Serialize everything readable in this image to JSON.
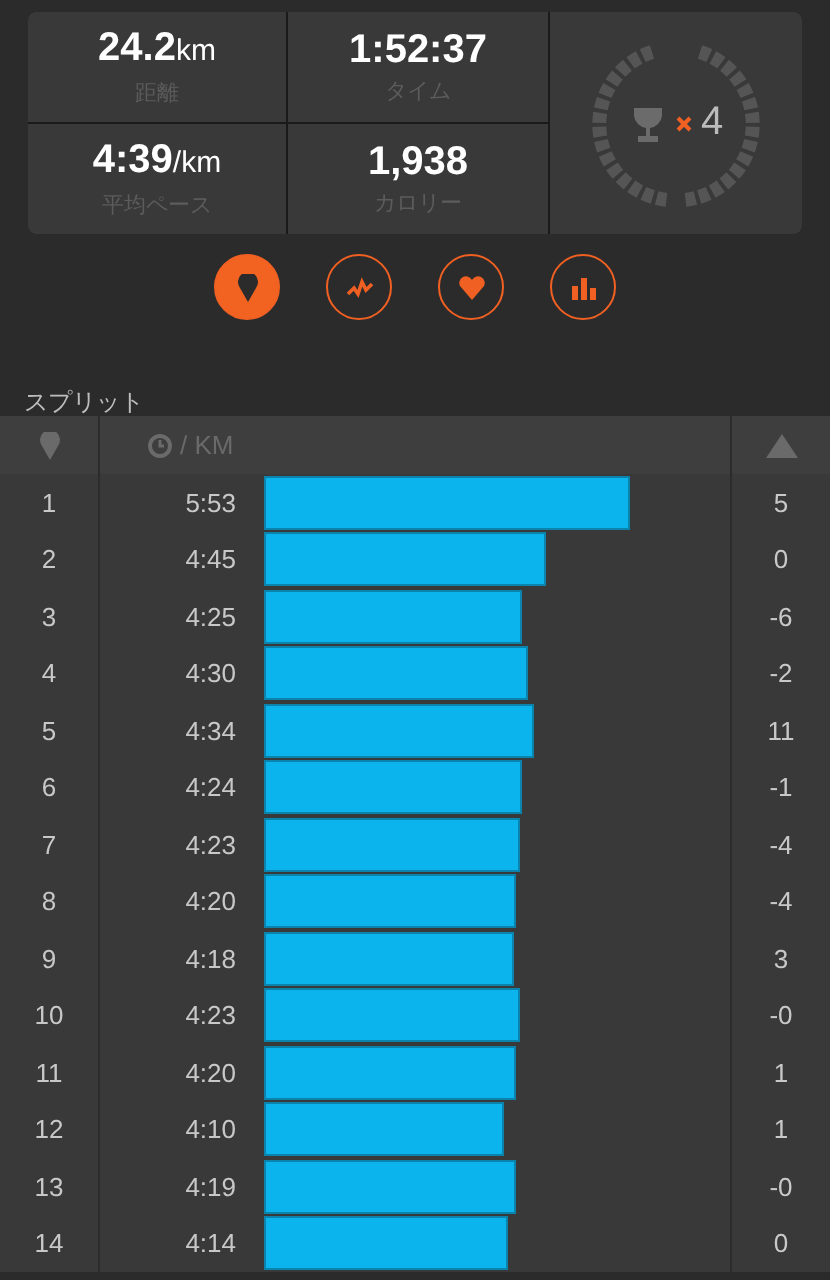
{
  "stats": [
    {
      "value": "24.2",
      "unit": "km",
      "label": "距離"
    },
    {
      "value": "1:52:37",
      "label": "タイム"
    },
    {
      "value": "4:39",
      "unit": "/km",
      "label": "平均ペース"
    },
    {
      "value": "1,938",
      "label": "カロリー"
    }
  ],
  "trophy": {
    "count": "4"
  },
  "view_tabs": [
    {
      "kind": "pin",
      "selected": true
    },
    {
      "kind": "pulse",
      "selected": false
    },
    {
      "kind": "heart",
      "selected": false
    },
    {
      "kind": "bars",
      "selected": false
    }
  ],
  "section_title": "スプリット",
  "table": {
    "pace_header": "/ KM",
    "rows": [
      {
        "km": "1",
        "pace": "5:53",
        "elevation": "5"
      },
      {
        "km": "2",
        "pace": "4:45",
        "elevation": "0"
      },
      {
        "km": "3",
        "pace": "4:25",
        "elevation": "-6"
      },
      {
        "km": "4",
        "pace": "4:30",
        "elevation": "-2"
      },
      {
        "km": "5",
        "pace": "4:34",
        "elevation": "11"
      },
      {
        "km": "6",
        "pace": "4:24",
        "elevation": "-1"
      },
      {
        "km": "7",
        "pace": "4:23",
        "elevation": "-4"
      },
      {
        "km": "8",
        "pace": "4:20",
        "elevation": "-4"
      },
      {
        "km": "9",
        "pace": "4:18",
        "elevation": "3"
      },
      {
        "km": "10",
        "pace": "4:23",
        "elevation": "-0"
      },
      {
        "km": "11",
        "pace": "4:20",
        "elevation": "1"
      },
      {
        "km": "12",
        "pace": "4:10",
        "elevation": "1"
      },
      {
        "km": "13",
        "pace": "4:19",
        "elevation": "-0"
      },
      {
        "km": "14",
        "pace": "4:14",
        "elevation": "0"
      }
    ]
  }
}
